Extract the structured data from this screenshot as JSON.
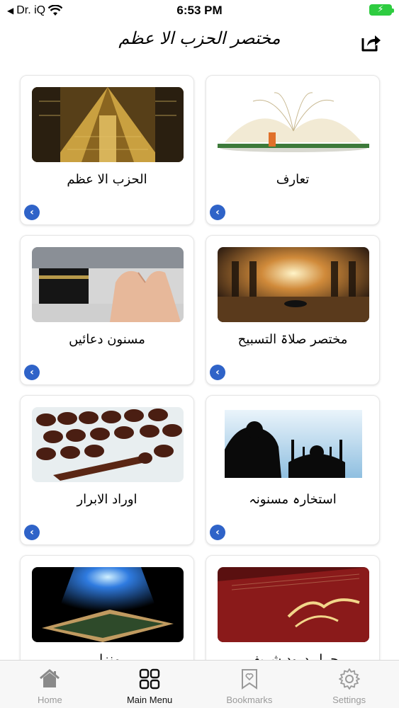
{
  "status_bar": {
    "back_label": "Dr. iQ",
    "time": "6:53 PM",
    "battery_bolt": "⚡"
  },
  "header": {
    "title": "مختصر الحزب الا عظم"
  },
  "cards": [
    {
      "title": "الحزب الا عظم",
      "arrow": "‹"
    },
    {
      "title": "تعارف",
      "arrow": "‹"
    },
    {
      "title": "مسنون دعائیں",
      "arrow": "‹"
    },
    {
      "title": "مختصر صلاۃ التسبیح",
      "arrow": "‹"
    },
    {
      "title": "اوراد الابرار",
      "arrow": "‹"
    },
    {
      "title": "استخارہ مسنونہ",
      "arrow": "‹"
    },
    {
      "title": "منزل",
      "arrow": "‹"
    },
    {
      "title": "چہل درود شریف",
      "arrow": "‹"
    }
  ],
  "tabs": [
    {
      "label": "Home",
      "icon": "home-icon"
    },
    {
      "label": "Main Menu",
      "icon": "grid-icon"
    },
    {
      "label": "Bookmarks",
      "icon": "bookmark-icon"
    },
    {
      "label": "Settings",
      "icon": "gear-icon"
    }
  ],
  "colors": {
    "accent": "#2f63c8",
    "battery": "#2ecc40"
  }
}
